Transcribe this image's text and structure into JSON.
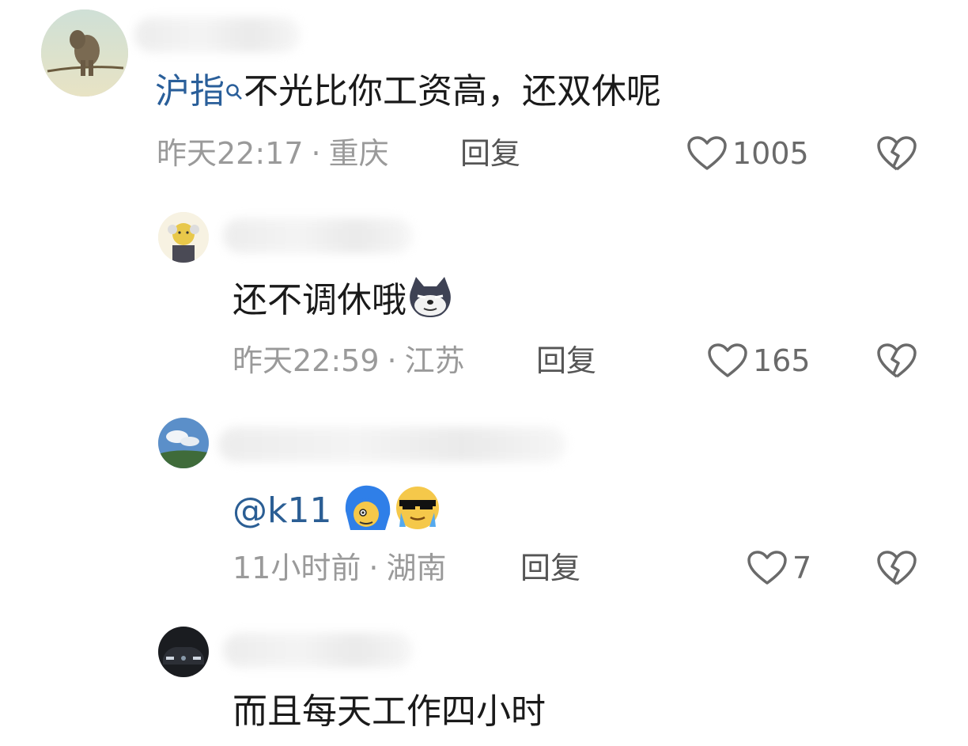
{
  "comments": [
    {
      "hot_tag": "沪指",
      "text": "不光比你工资高，还双休呢",
      "time": "昨天22:17",
      "location": "重庆",
      "reply_label": "回复",
      "likes": "1005"
    },
    {
      "text": "还不调休哦",
      "time": "昨天22:59",
      "location": "江苏",
      "reply_label": "回复",
      "likes": "165"
    },
    {
      "mention": "@k11",
      "time": "11小时前",
      "location": "湖南",
      "reply_label": "回复",
      "likes": "7"
    },
    {
      "text": "而且每天工作四小时"
    }
  ],
  "separator": "·",
  "icons": {
    "like": "heart-outline-icon",
    "dislike": "broken-heart-icon",
    "search": "search-icon"
  },
  "colors": {
    "link": "#2a5f9a",
    "meta": "#9a9a9a",
    "icon": "#6a6a6a"
  }
}
